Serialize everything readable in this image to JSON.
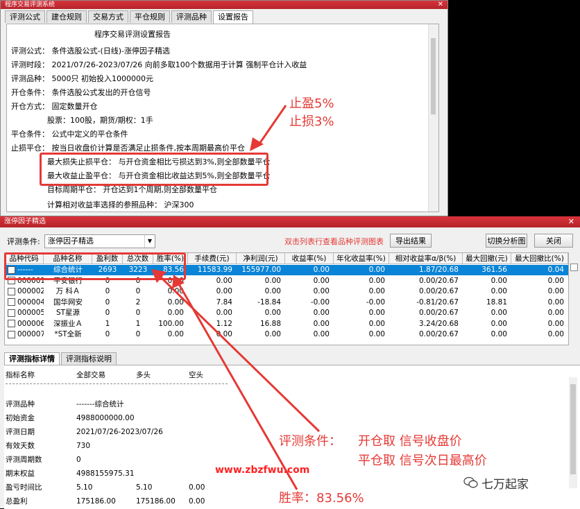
{
  "win1": {
    "title": "程序交易评测系统",
    "tabs": [
      "评测公式",
      "建仓规则",
      "交易方式",
      "平仓规则",
      "评测品种",
      "设置报告"
    ],
    "report": {
      "heading": "程序交易评测设置报告",
      "lines": [
        "评测公式：  条件选股公式-(日线)-涨停因子精选",
        "评测时段：  2021/07/26-2023/07/26 向前多取100个数据用于计算 强制平仓计入收益",
        "评测品种：  5000只  初始投入1000000元",
        "开仓条件：  条件选股公式发出的开仓信号",
        "开仓方式：  固定数量开仓",
        "股票：100股，期货/期权：1手",
        "平仓条件：  公式中定义的平仓条件",
        "止损平仓：  按当日收盘价计算是否满足止损条件,按本周期最高价平仓",
        "最大损失止损平仓：  与开仓资金相比亏损达到3%,则全部数量平仓",
        "最大收益止盈平仓：  与开仓资金相比收益达到5%,则全部数量平仓",
        "目标周期平仓：  开仓达到1个周期,则全部数量平仓",
        "计算相对收益率选择的参照品种：  沪深300"
      ]
    },
    "annotation": [
      "止盈5%",
      "止损3%"
    ]
  },
  "win2": {
    "title": "涨停因子精选",
    "cond_label": "评测条件:",
    "cond_value": "涨停因子精选",
    "hint": "双击列表行查看品种评测图表",
    "export_btn": "导出结果",
    "switch_btn": "切换分析图",
    "close_btn": "关闭",
    "columns": [
      "品种代码",
      "品种名称",
      "盈利数",
      "总次数",
      "胜率(%)",
      "手续费(元)",
      "净利润(元)",
      "收益率(%)",
      "年化收益率(%)",
      "相对收益率α/β(%)",
      "最大回撤(元)",
      "最大回撤比(%)"
    ],
    "rows": [
      [
        "------",
        "综合统计",
        "2693",
        "3223",
        "83.56",
        "11583.99",
        "155977.00",
        "0.00",
        "0.00",
        "1.87/20.68",
        "361.56",
        "0.04"
      ],
      [
        "000001",
        "平安银行",
        "0",
        "0",
        "0.00",
        "0.00",
        "0.00",
        "0.00",
        "0.00",
        "0.00/20.67",
        "0.00",
        "0.00"
      ],
      [
        "000002",
        "万 科Ａ",
        "0",
        "0",
        "0.00",
        "0.00",
        "0.00",
        "0.00",
        "0.00",
        "0.00/20.67",
        "0.00",
        "0.00"
      ],
      [
        "000004",
        "国华网安",
        "0",
        "2",
        "0.00",
        "7.84",
        "-18.84",
        "-0.00",
        "-0.00",
        "-0.81/20.67",
        "18.81",
        "0.00"
      ],
      [
        "000005",
        "ST星源",
        "0",
        "0",
        "0.00",
        "0.00",
        "0.00",
        "0.00",
        "0.00",
        "0.00/20.67",
        "0.00",
        "0.00"
      ],
      [
        "000006",
        "深振业Ａ",
        "1",
        "1",
        "100.00",
        "1.12",
        "16.88",
        "0.00",
        "0.00",
        "3.24/20.68",
        "0.00",
        "0.00"
      ],
      [
        "000007",
        "*ST全新",
        "0",
        "0",
        "0.00",
        "0.00",
        "0.00",
        "0.00",
        "0.00",
        "0.00/20.67",
        "0.00",
        "0.00"
      ]
    ],
    "tabs": [
      "评测指标详情",
      "评测指标说明"
    ],
    "detail_header": [
      "指标名称",
      "全部交易",
      "多头",
      "空头"
    ],
    "detail": [
      [
        "评测品种",
        "-------综合统计",
        "",
        ""
      ],
      [
        "初始资金",
        "4988000000.00",
        "",
        ""
      ],
      [
        "评测日期",
        "2021/07/26-2023/07/26",
        "",
        ""
      ],
      [
        "有效天数",
        "730",
        "",
        ""
      ],
      [
        "评测周期数",
        "0",
        "",
        ""
      ],
      [
        "期末权益",
        "4988155975.31",
        "",
        ""
      ],
      [
        "盈亏时间比",
        "5.10",
        "5.10",
        "0.00"
      ],
      [
        "总盈利",
        "175186.00",
        "175186.00",
        "0.00"
      ]
    ],
    "watermark": "www.zbzfwu.com",
    "annotation": {
      "cond_label": "评测条件：",
      "open": "开仓取  信号收盘价",
      "close": "平仓取  信号次日最高价",
      "rate": "胜率：83.56%"
    },
    "brand": "七万起家"
  },
  "colors": {
    "accent_red": "#e53935",
    "selection_blue": "#0a84d6",
    "titlebar": "#c62a31"
  }
}
